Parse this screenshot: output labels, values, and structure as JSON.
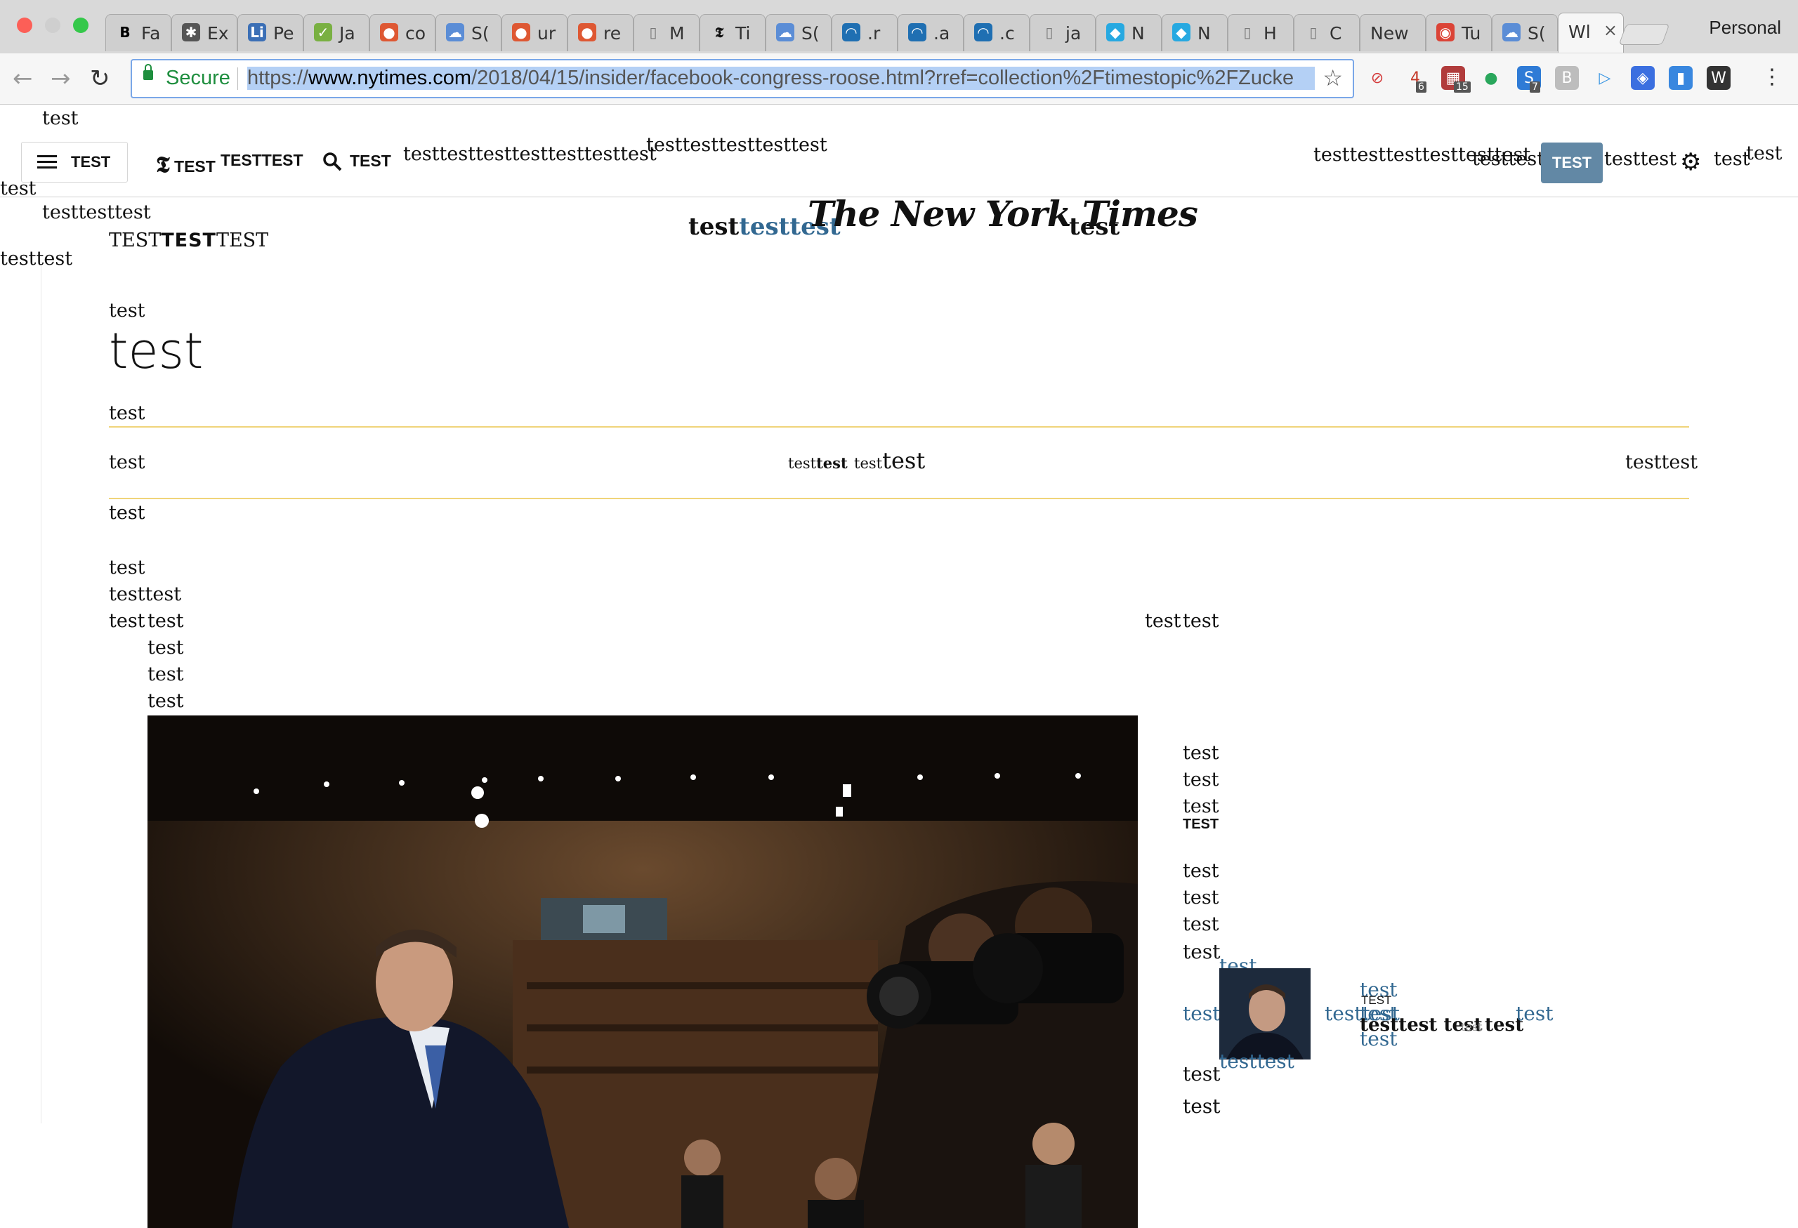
{
  "browser": {
    "tabs": [
      {
        "label": "Fa",
        "icon": "bold-b-icon",
        "fav": "B",
        "color": "#000000"
      },
      {
        "label": "Ex",
        "icon": "puzzle-icon",
        "fav": "✱",
        "color": "#555555"
      },
      {
        "label": "Pe",
        "icon": "linkedin-icon",
        "fav": "Li",
        "color": "#3b6fb6"
      },
      {
        "label": "Ja",
        "icon": "jsfiddle-icon",
        "fav": "✓",
        "color": "#79b042"
      },
      {
        "label": "co",
        "icon": "duckduckgo-icon",
        "fav": "●",
        "color": "#de5833"
      },
      {
        "label": "S(",
        "icon": "cloud-icon",
        "fav": "☁",
        "color": "#5b8dd6"
      },
      {
        "label": "ur",
        "icon": "duckduckgo-icon",
        "fav": "●",
        "color": "#de5833"
      },
      {
        "label": "re",
        "icon": "duckduckgo-icon",
        "fav": "●",
        "color": "#de5833"
      },
      {
        "label": "M",
        "icon": "document-icon",
        "fav": "▯",
        "color": "#777777"
      },
      {
        "label": "Ti",
        "icon": "nyt-t-icon",
        "fav": "𝕿",
        "color": "#111111"
      },
      {
        "label": "S(",
        "icon": "cloud-icon",
        "fav": "☁",
        "color": "#5b8dd6"
      },
      {
        "label": ".r",
        "icon": "jquery-icon",
        "fav": "◠",
        "color": "#1f6fb2"
      },
      {
        "label": ".a",
        "icon": "jquery-icon",
        "fav": "◠",
        "color": "#1f6fb2"
      },
      {
        "label": ".c",
        "icon": "jquery-icon",
        "fav": "◠",
        "color": "#1f6fb2"
      },
      {
        "label": "ja",
        "icon": "document-icon",
        "fav": "▯",
        "color": "#777777"
      },
      {
        "label": "N",
        "icon": "ninja-icon",
        "fav": "◆",
        "color": "#27a9e1"
      },
      {
        "label": "N",
        "icon": "ninja-icon",
        "fav": "◆",
        "color": "#27a9e1"
      },
      {
        "label": "H",
        "icon": "document-icon",
        "fav": "▯",
        "color": "#777777"
      },
      {
        "label": "C",
        "icon": "document-icon",
        "fav": "▯",
        "color": "#777777"
      },
      {
        "label": "New",
        "icon": "",
        "fav": "",
        "color": "#cccccc"
      },
      {
        "label": "Tu",
        "icon": "chrome-icon",
        "fav": "◉",
        "color": "#db4437"
      },
      {
        "label": "S(",
        "icon": "cloud-icon",
        "fav": "☁",
        "color": "#5b8dd6"
      },
      {
        "label": "Wl",
        "icon": "",
        "fav": "",
        "color": "#cccccc",
        "active": true
      }
    ],
    "profile": "Personal",
    "secure_label": "Secure",
    "url_scheme": "https://",
    "url_host": "www.nytimes.com",
    "url_path": "/2018/04/15/insider/facebook-congress-roose.html?rref=collection%2Ftimestopic%2FZucke",
    "extensions": [
      {
        "icon": "cancel-ext-icon",
        "text": "⊘",
        "color": "#d43c3c",
        "badge": ""
      },
      {
        "icon": "four-ext-icon",
        "text": "4",
        "color": "#c43828",
        "badge": "6"
      },
      {
        "icon": "calendar-ext-icon",
        "text": "▦",
        "color": "#b13c3c",
        "badge": "15"
      },
      {
        "icon": "chat-ext-icon",
        "text": "●",
        "color": "#2aa75c",
        "badge": ""
      },
      {
        "icon": "s-ext-icon",
        "text": "S",
        "color": "#2f7bd6",
        "badge": "7"
      },
      {
        "icon": "b-ext-icon",
        "text": "B",
        "color": "#bdbdbd",
        "badge": ""
      },
      {
        "icon": "play-ext-icon",
        "text": "▷",
        "color": "#3a96e2",
        "badge": ""
      },
      {
        "icon": "shield-ext-icon",
        "text": "◈",
        "color": "#3b6fe0",
        "badge": ""
      },
      {
        "icon": "doc-ext-icon",
        "text": "▮",
        "color": "#3987df",
        "badge": ""
      },
      {
        "icon": "w-ext-icon",
        "text": "W",
        "color": "#333333",
        "badge": ""
      }
    ]
  },
  "nyt": {
    "top_test": "test",
    "menu_label": "TEST",
    "brand_small": "TEST",
    "brand_small_2": "TESTTEST",
    "search_label": "TEST",
    "nav_a": "testtesttesttesttesttesttest",
    "nav_b": "testtesttesttesttest",
    "right_a": "testtesttesttesttesttest",
    "right_b": "testtest",
    "subscribe": "TEST",
    "right_c": "testtest",
    "right_d": "test",
    "right_e": "test",
    "left_1": "test",
    "left_2": "testtesttest",
    "left_3": "testtest",
    "section_a": "TEST",
    "section_b": "TEST",
    "section_c": "TEST",
    "logo_pre_a": "test",
    "logo_pre_b": "testtest",
    "logo_text": "The New York Times",
    "logo_post": "test",
    "kicker": "test",
    "headline": "test",
    "byline": "test",
    "share_left": "test",
    "share_mid_a": "test",
    "share_mid_b": "test",
    "share_mid_c": "test",
    "share_mid_d": "test",
    "share_right": "testtest",
    "after_rule": "test",
    "lines_a": [
      "test",
      "testtest"
    ],
    "row_a": "test",
    "row_b": "test",
    "row_right_a": "test",
    "row_right_b": "test",
    "list_b": [
      "test",
      "test",
      "test"
    ],
    "side_a": [
      "test",
      "test",
      "test"
    ],
    "side_bold": "TEST",
    "side_b": [
      "test",
      "test",
      "test",
      "test"
    ],
    "promo": {
      "left": "test",
      "over": "test",
      "under": "testtest",
      "mid": "testtest",
      "stack_top": "test",
      "stack_label": "TEST",
      "stack_link": "test",
      "stack_link2": "test",
      "stack_bold": "testtest test",
      "stack_grey": "test",
      "stack_bold2": "test",
      "right": "test"
    },
    "side_c": [
      "test",
      "test"
    ]
  }
}
